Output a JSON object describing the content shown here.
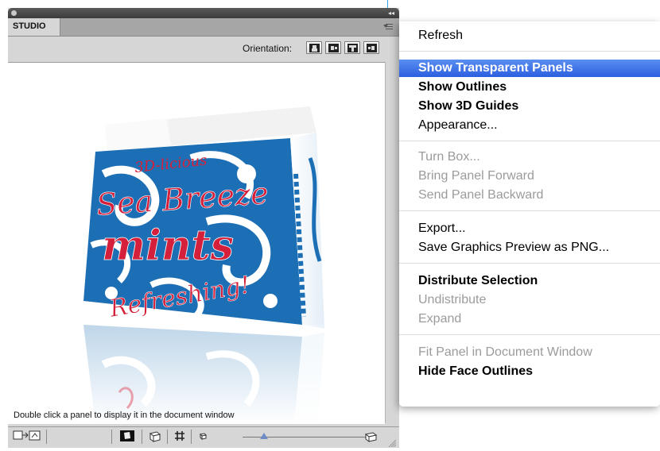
{
  "panel": {
    "tab_label": "STUDIO",
    "orientation_label": "Orientation:",
    "status_text": "Double click a panel to display it in the document window",
    "collapse_glyph": "◂◂"
  },
  "artwork": {
    "line1": "3D-licious",
    "line2": "Sea Breeze",
    "line3": "mints",
    "line4": "Refreshing!",
    "colors": {
      "blue": "#1d6fb5",
      "red": "#d4203a",
      "light": "#cfe6f5"
    }
  },
  "menu": {
    "items": [
      {
        "label": "Refresh",
        "state": "enabled"
      },
      {
        "label": "Show Transparent Panels",
        "state": "highlighted"
      },
      {
        "label": "Show Outlines",
        "state": "bold"
      },
      {
        "label": "Show 3D Guides",
        "state": "bold"
      },
      {
        "label": "Appearance...",
        "state": "enabled"
      },
      {
        "label": "Turn Box...",
        "state": "disabled"
      },
      {
        "label": "Bring Panel Forward",
        "state": "disabled"
      },
      {
        "label": "Send Panel Backward",
        "state": "disabled"
      },
      {
        "label": "Export...",
        "state": "enabled"
      },
      {
        "label": "Save Graphics Preview as PNG...",
        "state": "enabled"
      },
      {
        "label": "Distribute Selection",
        "state": "bold"
      },
      {
        "label": "Undistribute",
        "state": "disabled"
      },
      {
        "label": "Expand",
        "state": "disabled"
      },
      {
        "label": "Fit Panel in Document Window",
        "state": "disabled"
      },
      {
        "label": "Hide Face Outlines",
        "state": "bold"
      }
    ]
  },
  "colors": {
    "highlight": "#3a6fe6",
    "panel_bg": "#d6d6d6",
    "titlebar": "#454545",
    "guide": "#2ea7e8"
  }
}
